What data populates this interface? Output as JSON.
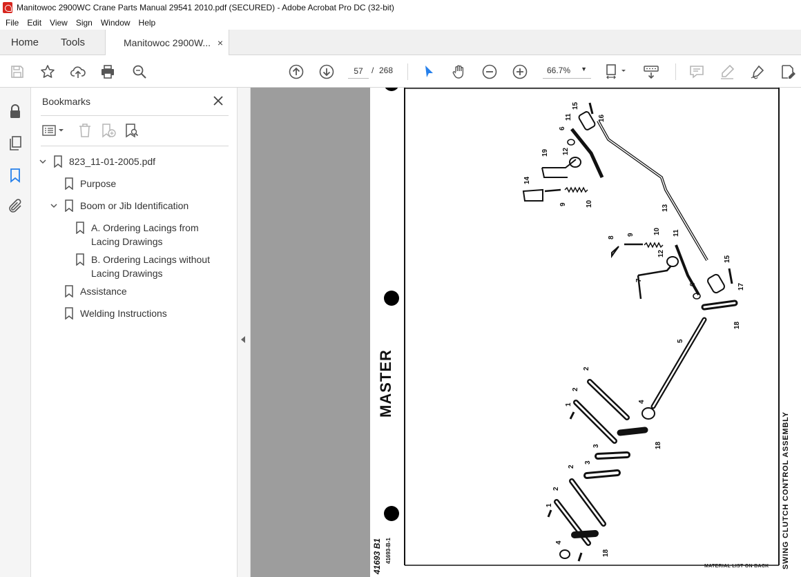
{
  "window": {
    "title": "Manitowoc 2900WC Crane Parts Manual 29541 2010.pdf (SECURED) - Adobe Acrobat Pro DC (32-bit)"
  },
  "menu": [
    "File",
    "Edit",
    "View",
    "Sign",
    "Window",
    "Help"
  ],
  "tabs": {
    "home": "Home",
    "tools": "Tools",
    "document": "Manitowoc 2900W...",
    "close": "×"
  },
  "toolbar": {
    "current_page": "57",
    "page_separator": "/",
    "total_pages": "268",
    "zoom": "66.7%"
  },
  "bookmarks": {
    "title": "Bookmarks",
    "items": [
      {
        "label": "823_11-01-2005.pdf",
        "level": 0,
        "expanded": true
      },
      {
        "label": "Purpose",
        "level": 1
      },
      {
        "label": "Boom or Jib Identification",
        "level": 1,
        "expanded": true
      },
      {
        "label": "A. Ordering Lacings from Lacing Drawings",
        "level": 2
      },
      {
        "label": "B. Ordering Lacings without Lacing Drawings",
        "level": 2
      },
      {
        "label": "Assistance",
        "level": 1
      },
      {
        "label": "Welding Instructions",
        "level": 1
      }
    ]
  },
  "document": {
    "stamp": "MASTER",
    "drawing_title": "SWING CLUTCH CONTROL ASSEMBLY",
    "material_note": "MATERIAL LIST ON BACK",
    "drawing_number": "41693 B1",
    "drawing_ref": "41693-B-1",
    "callouts": [
      "15",
      "16",
      "11",
      "6",
      "12",
      "19",
      "14",
      "9",
      "10",
      "13",
      "8",
      "9",
      "10",
      "11",
      "12",
      "7",
      "6",
      "15",
      "17",
      "18",
      "5",
      "2",
      "2",
      "4",
      "1",
      "3",
      "18",
      "3",
      "2",
      "2",
      "1",
      "4",
      "18"
    ]
  },
  "colors": {
    "accent": "#1a73e8",
    "pointer_active": "#2680eb",
    "doc_background": "#9d9d9d"
  }
}
